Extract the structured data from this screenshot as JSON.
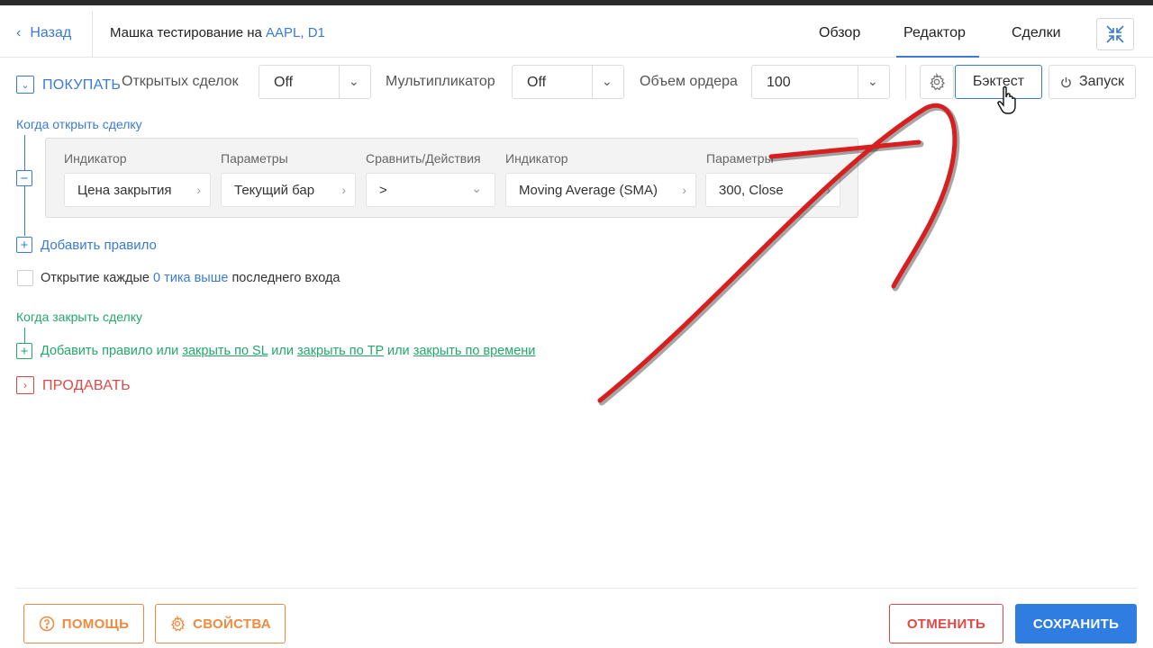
{
  "header": {
    "back_label": "Назад",
    "title_prefix": "Машка тестирование на ",
    "title_highlight": "AAPL, D1",
    "tabs": [
      {
        "label": "Обзор"
      },
      {
        "label": "Редактор",
        "active": true
      },
      {
        "label": "Сделки"
      }
    ]
  },
  "toolbar": {
    "buy_label": "ПОКУПАТЬ",
    "open_trades_label": "Открытых сделок",
    "open_trades_value": "Off",
    "multiplier_label": "Мультипликатор",
    "multiplier_value": "Off",
    "order_volume_label": "Объем ордера",
    "order_volume_value": "100",
    "backtest_label": "Бэктест",
    "launch_label": "Запуск"
  },
  "open_section": {
    "title": "Когда открыть сделку",
    "columns": [
      "Индикатор",
      "Параметры",
      "Сравнить/Действия",
      "Индикатор",
      "Параметры"
    ],
    "rule": {
      "indicator1": "Цена закрытия",
      "params1": "Текущий бар",
      "compare": ">",
      "indicator2": "Moving Average (SMA)",
      "params2": "300, Close"
    },
    "add_rule": "Добавить правило",
    "tick_prefix": "Открытие каждые",
    "tick_link": "0 тика выше",
    "tick_suffix": "последнего входа"
  },
  "close_section": {
    "title": "Когда закрыть сделку",
    "add_rule": "Добавить правило",
    "or1": "или",
    "close_sl": "закрыть по SL",
    "or2": "или",
    "close_tp": "закрыть по TP",
    "or3": "или",
    "close_time": "закрыть по времени"
  },
  "sell_label": "ПРОДАВАТЬ",
  "footer": {
    "help": "ПОМОЩЬ",
    "properties": "СВОЙСТВА",
    "cancel": "ОТМЕНИТЬ",
    "save": "СОХРАНИТЬ"
  },
  "colors": {
    "accent": "#3a7bd5",
    "green": "#23a86b",
    "red": "#e04848",
    "orange": "#f08a3e",
    "save_blue": "#2f7de1",
    "annotation_arrow": "#d81e1e"
  },
  "icons": [
    "chevron-left-icon",
    "collapse-icon",
    "chevron-down-icon",
    "gear-icon",
    "power-icon",
    "minus-icon",
    "plus-icon",
    "chevron-right-icon",
    "help-icon",
    "hand-cursor-icon",
    "arrow-annotation"
  ]
}
